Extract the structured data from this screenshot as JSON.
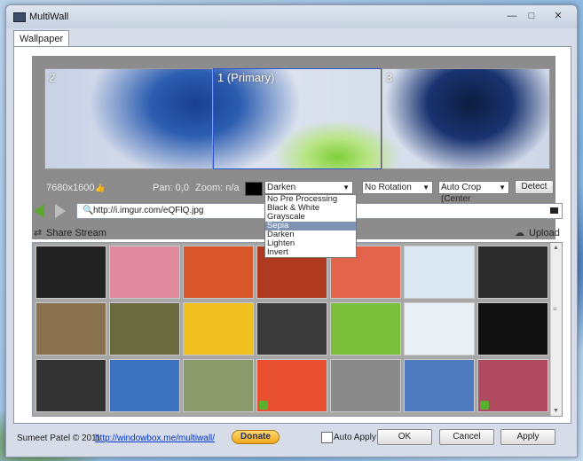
{
  "window": {
    "title": "MultiWall",
    "min_icon": "minimize-icon",
    "max_icon": "maximize-icon",
    "close_icon": "close-icon"
  },
  "tabs": [
    {
      "label": "Wallpaper"
    }
  ],
  "preview": {
    "monitors": [
      {
        "label": "2"
      },
      {
        "label": "1 (Primary)"
      },
      {
        "label": "3"
      }
    ],
    "resolution": "7680x1600",
    "pan": "Pan: 0,0",
    "zoom": "Zoom: n/a"
  },
  "controls": {
    "processing": {
      "selected": "Darken",
      "options": [
        "No Pre Processing",
        "Black & White",
        "Grayscale",
        "Sepia",
        "Darken",
        "Lighten",
        "Invert"
      ],
      "highlighted": "Sepia"
    },
    "rotation": {
      "selected": "No Rotation"
    },
    "crop": {
      "selected": "Auto Crop (Center"
    },
    "detect_label": "Detect"
  },
  "url_bar": {
    "value": "http://i.imgur.com/eQFlQ.jpg"
  },
  "share_stream_label": "Share Stream",
  "upload_label": "Upload",
  "thumbnails": [
    {
      "color": "#222"
    },
    {
      "color": "#e08aa0"
    },
    {
      "color": "#d9562a"
    },
    {
      "color": "#b03a20"
    },
    {
      "color": "#e3644a"
    },
    {
      "color": "#dbe7f2"
    },
    {
      "color": "#2b2b2b"
    },
    {
      "color": "#8a7150"
    },
    {
      "color": "#6a6a40"
    },
    {
      "color": "#f0c020"
    },
    {
      "color": "#3a3a3a"
    },
    {
      "color": "#7cbf3a"
    },
    {
      "color": "#e9f0f5"
    },
    {
      "color": "#111"
    },
    {
      "color": "#333"
    },
    {
      "color": "#3d73c0"
    },
    {
      "color": "#8a9a6a"
    },
    {
      "color": "#e85030"
    },
    {
      "color": "#8a8a8a"
    },
    {
      "color": "#4e7bbf"
    },
    {
      "color": "#b04a60"
    }
  ],
  "footer": {
    "copyright": "Sumeet Patel © 2011",
    "link": "http://windowbox.me/multiwall/",
    "donate": "Donate",
    "auto_apply": "Auto Apply",
    "ok": "OK",
    "cancel": "Cancel",
    "apply": "Apply"
  }
}
